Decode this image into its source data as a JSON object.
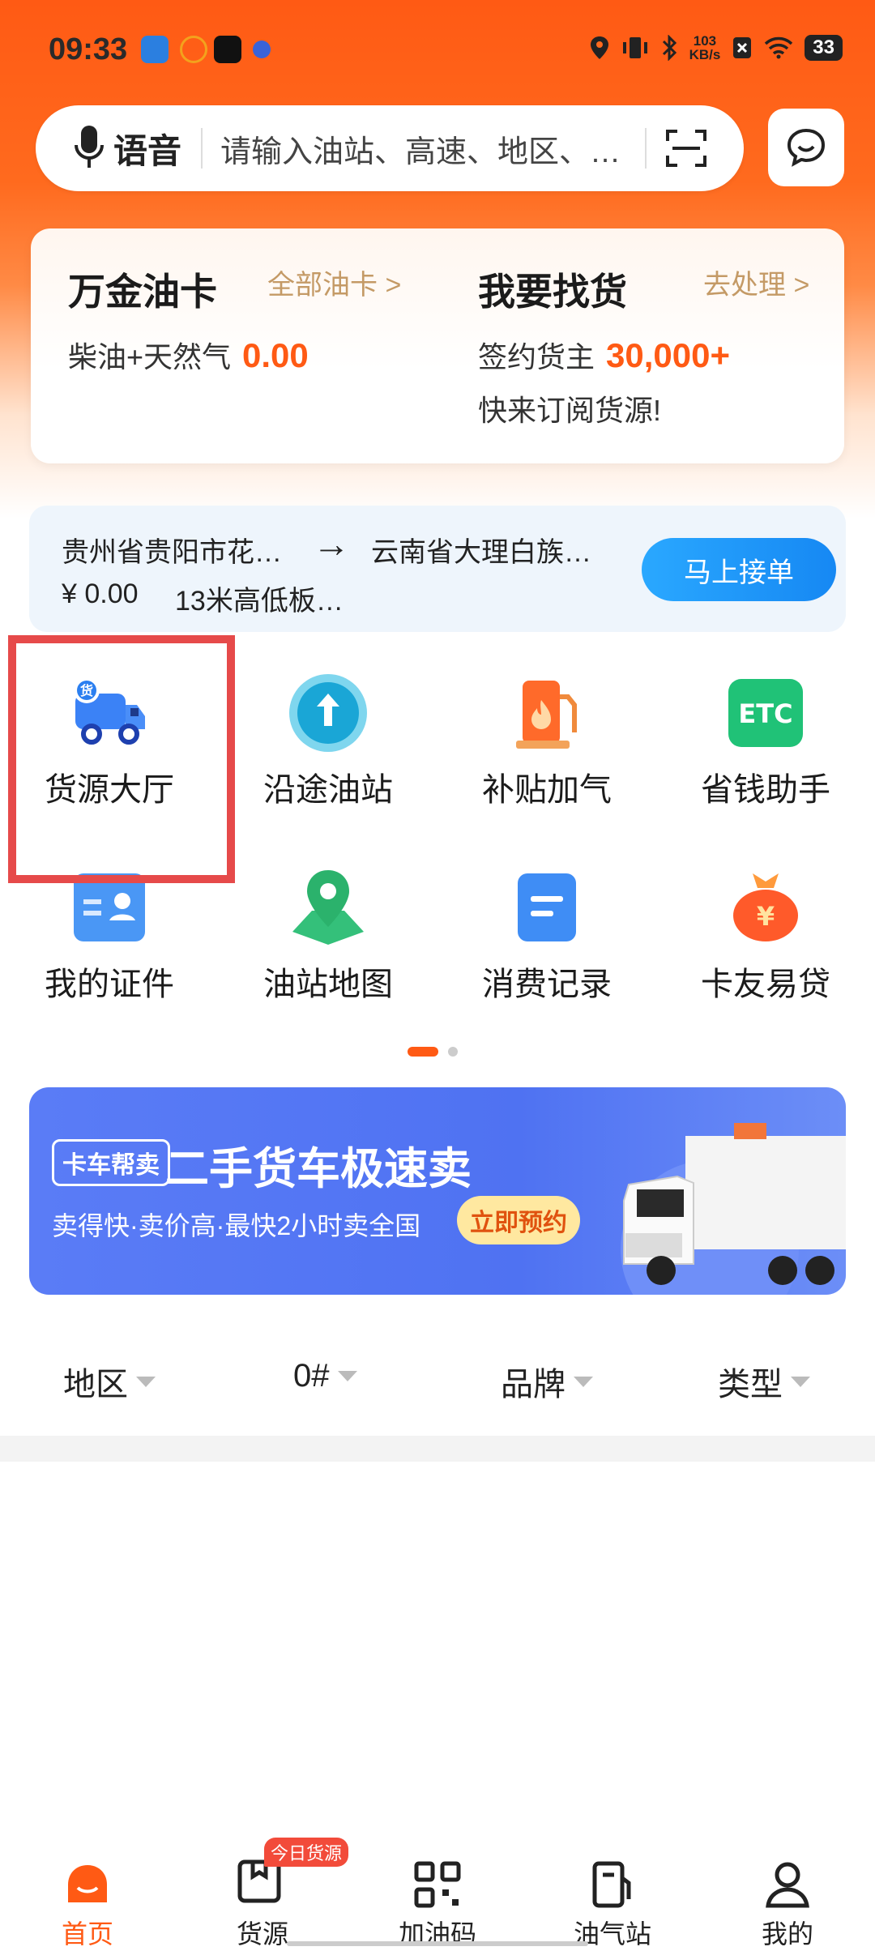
{
  "status_bar": {
    "time": "09:33",
    "speed_value": "103",
    "speed_unit": "KB/s",
    "battery": "33"
  },
  "search": {
    "voice_label": "语音",
    "placeholder": "请输入油站、高速、地区、…"
  },
  "card": {
    "left": {
      "title": "万金油卡",
      "link": "全部油卡 >",
      "sub_label": "柴油+天然气",
      "value": "0.00"
    },
    "right": {
      "title": "我要找货",
      "link": "去处理 >",
      "sub_label": "签约货主",
      "value": "30,000+",
      "note": "快来订阅货源!"
    }
  },
  "order": {
    "from": "贵州省贵阳市花…",
    "arrow": "→",
    "to": "云南省大理白族…",
    "price": "¥ 0.00",
    "cargo": "13米高低板…",
    "button": "马上接单"
  },
  "grid": {
    "items": [
      {
        "label": "货源大厅",
        "icon": "truck-icon"
      },
      {
        "label": "沿途油站",
        "icon": "route-icon"
      },
      {
        "label": "补贴加气",
        "icon": "gas-pump-icon"
      },
      {
        "label": "省钱助手",
        "icon": "etc-icon"
      },
      {
        "label": "我的证件",
        "icon": "id-card-icon"
      },
      {
        "label": "油站地图",
        "icon": "map-pin-icon"
      },
      {
        "label": "消费记录",
        "icon": "record-icon"
      },
      {
        "label": "卡友易贷",
        "icon": "money-bag-icon"
      }
    ],
    "etc_text": "ETC",
    "cargo_badge": "货"
  },
  "banner": {
    "tag": "卡车帮卖",
    "title": "二手货车极速卖",
    "subtitle": "卖得快·卖价高·最快2小时卖全国",
    "button": "立即预约"
  },
  "filters": [
    "地区",
    "0#",
    "品牌",
    "类型"
  ],
  "bottom_nav": {
    "items": [
      {
        "label": "首页",
        "icon": "home-icon",
        "active": true
      },
      {
        "label": "货源",
        "icon": "cargo-box-icon",
        "active": false
      },
      {
        "label": "加油码",
        "icon": "qr-code-icon",
        "active": false
      },
      {
        "label": "油气站",
        "icon": "fuel-station-icon",
        "active": false
      },
      {
        "label": "我的",
        "icon": "profile-icon",
        "active": false
      }
    ],
    "badge": "今日货源"
  },
  "colors": {
    "brand": "#ff5a14",
    "link": "#c49a66",
    "order_button": "#1688f3",
    "highlight": "#e64a4a"
  }
}
